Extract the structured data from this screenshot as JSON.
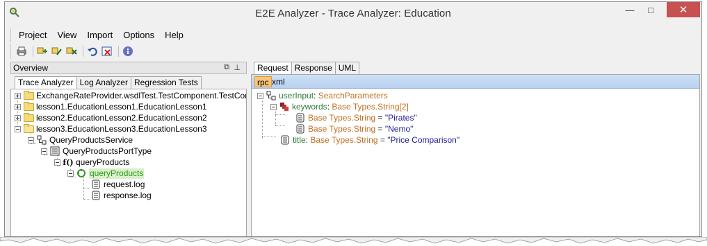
{
  "window": {
    "title": "E2E Analyzer - Trace Analyzer: Education"
  },
  "menu": [
    "Project",
    "View",
    "Import",
    "Options",
    "Help"
  ],
  "toolbar": {
    "icons": [
      "print-icon",
      "trace-add-icon",
      "trace-edit-icon",
      "trace-remove-icon",
      "undo-icon",
      "delete-icon",
      "info-icon"
    ]
  },
  "overview": {
    "title": "Overview",
    "tabs": [
      "Trace Analyzer",
      "Log Analyzer",
      "Regression Tests"
    ],
    "active_tab": "Trace Analyzer"
  },
  "tree": {
    "items": [
      "ExchangeRateProvider.wsdlTest.TestComponent.TestCompo",
      "lesson1.EducationLesson1.EducationLesson1",
      "lesson2.EducationLesson2.EducationLesson2",
      "lesson3.EducationLesson3.EducationLesson3",
      "QueryProductsService",
      "QueryProductsPortType",
      "queryProducts",
      "queryProducts",
      "request.log",
      "response.log"
    ]
  },
  "detail": {
    "tabs": [
      "Request",
      "Response",
      "UML"
    ],
    "active_tab": "Request",
    "subtabs": [
      "rpc",
      "xml"
    ],
    "active_subtab": "rpc",
    "nodes": {
      "root": {
        "name": "userInput",
        "sep": ": ",
        "type": "SearchParameters"
      },
      "keywords": {
        "name": "keywords",
        "sep": ": ",
        "type": "Base Types.String[2]"
      },
      "kw1": {
        "type": "Base Types.String",
        "eq": " = ",
        "value": "\"Pirates\""
      },
      "kw2": {
        "type": "Base Types.String",
        "eq": " = ",
        "value": "\"Nemo\""
      },
      "title": {
        "name": "title",
        "sep": ": ",
        "type": "Base Types.String",
        "eq": " = ",
        "value": "\"Price Comparison\""
      }
    }
  },
  "colors": {
    "close_button": "#c75050",
    "folder": "#f5dc7a",
    "selected_node": "#2e9a1e",
    "active_subtab": "#f7c67a",
    "subtab_bar": "#b8d0f0"
  }
}
